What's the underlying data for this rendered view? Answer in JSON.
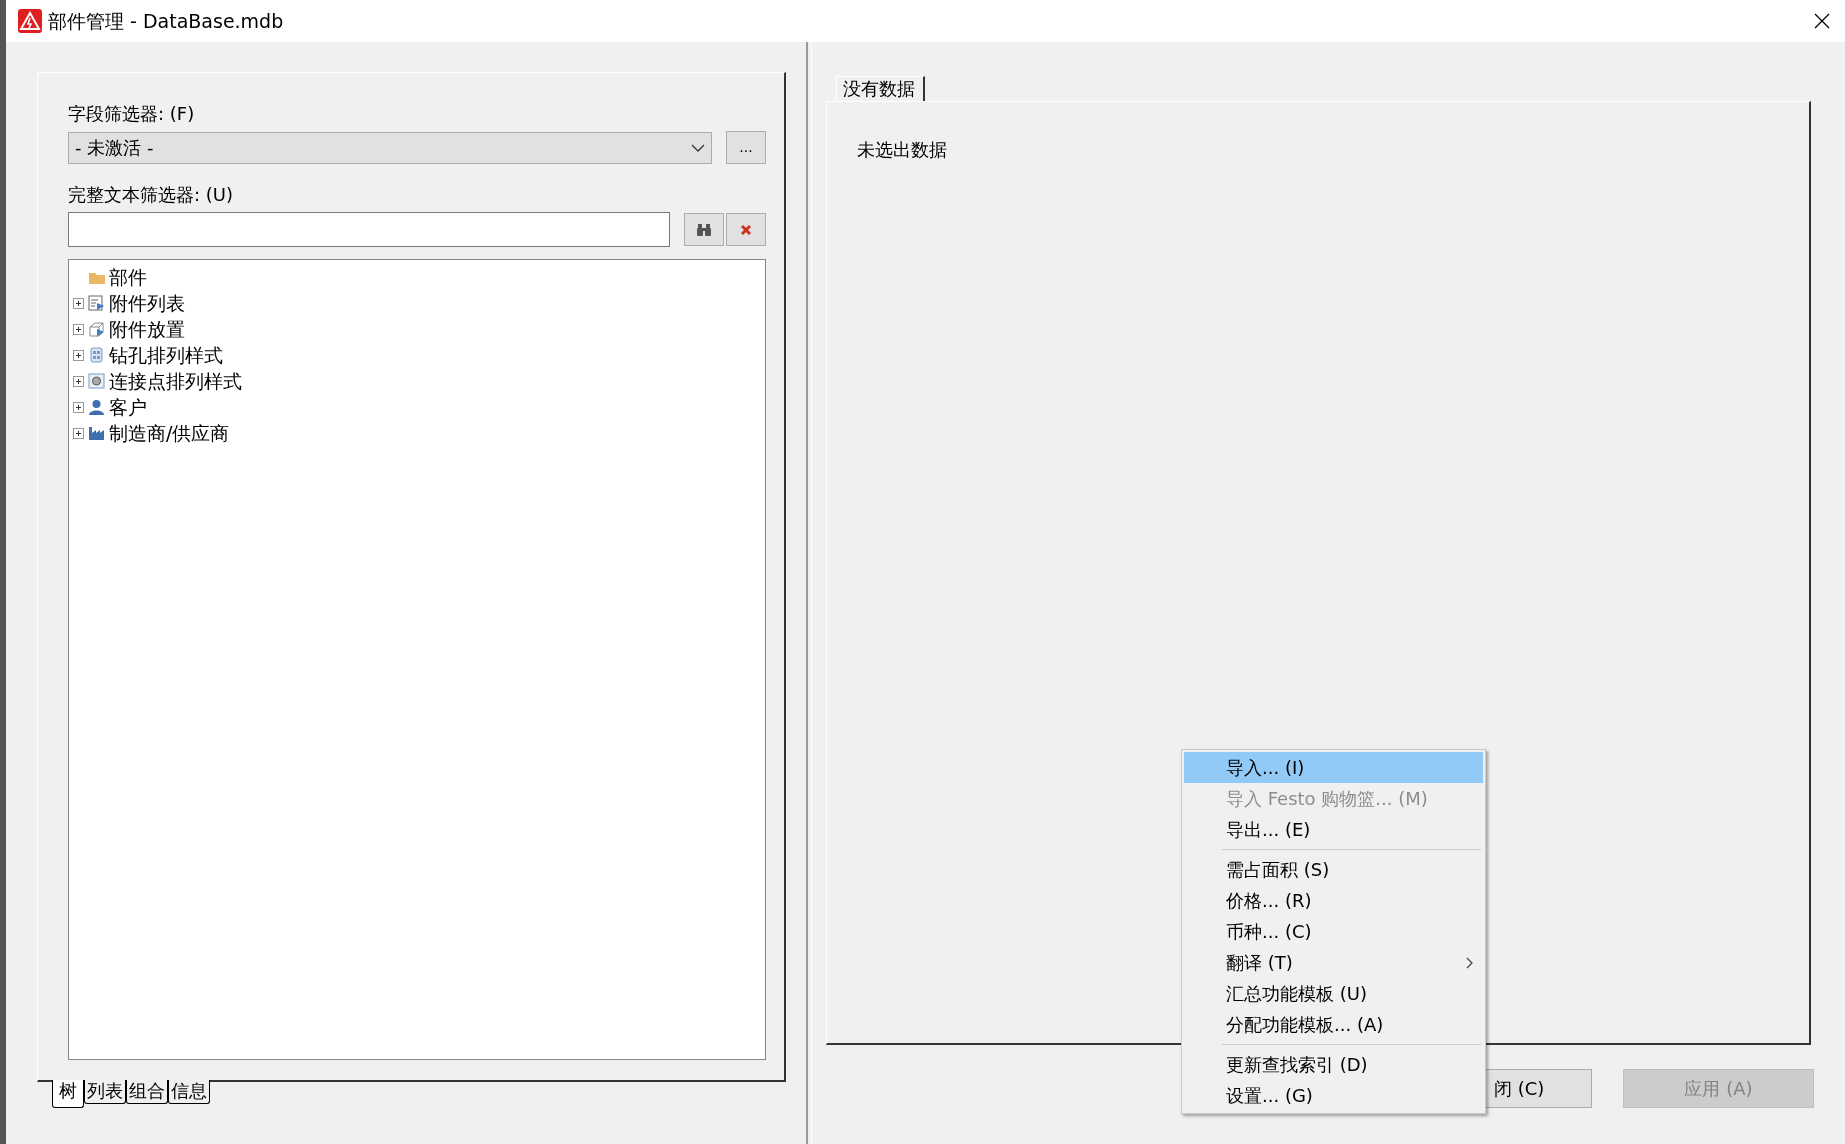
{
  "window": {
    "title": "部件管理 - DataBase.mdb"
  },
  "field_filter": {
    "label": "字段筛选器: (F)",
    "value": "- 未激活 -",
    "more_button": "..."
  },
  "text_filter": {
    "label": "完整文本筛选器: (U)"
  },
  "tree": [
    {
      "label": "部件",
      "kind": "folder",
      "expandable": false
    },
    {
      "label": "附件列表",
      "kind": "list",
      "expandable": true
    },
    {
      "label": "附件放置",
      "kind": "placement",
      "expandable": true
    },
    {
      "label": "钻孔排列样式",
      "kind": "drill",
      "expandable": true
    },
    {
      "label": "连接点排列样式",
      "kind": "connector",
      "expandable": true
    },
    {
      "label": "客户",
      "kind": "customer",
      "expandable": true
    },
    {
      "label": "制造商/供应商",
      "kind": "factory",
      "expandable": true
    }
  ],
  "left_tabs": [
    {
      "label": "树",
      "selected": true
    },
    {
      "label": "列表",
      "selected": false
    },
    {
      "label": "组合",
      "selected": false
    },
    {
      "label": "信息",
      "selected": false
    }
  ],
  "right_tab": {
    "label": "没有数据"
  },
  "right_message": "未选出数据",
  "buttons": [
    {
      "label": "闭 (C)",
      "disabled": false
    },
    {
      "label": "应用 (A)",
      "disabled": true
    }
  ],
  "context_menu": [
    {
      "kind": "item",
      "label": "导入... (I)",
      "selected": true,
      "disabled": false,
      "submenu": false
    },
    {
      "kind": "item",
      "label": "导入 Festo 购物篮... (M)",
      "selected": false,
      "disabled": true,
      "submenu": false
    },
    {
      "kind": "item",
      "label": "导出... (E)",
      "selected": false,
      "disabled": false,
      "submenu": false
    },
    {
      "kind": "separator"
    },
    {
      "kind": "item",
      "label": "需占面积 (S)",
      "selected": false,
      "disabled": false,
      "submenu": false
    },
    {
      "kind": "item",
      "label": "价格... (R)",
      "selected": false,
      "disabled": false,
      "submenu": false
    },
    {
      "kind": "item",
      "label": "币种... (C)",
      "selected": false,
      "disabled": false,
      "submenu": false
    },
    {
      "kind": "item",
      "label": "翻译 (T)",
      "selected": false,
      "disabled": false,
      "submenu": true
    },
    {
      "kind": "item",
      "label": "汇总功能模板 (U)",
      "selected": false,
      "disabled": false,
      "submenu": false
    },
    {
      "kind": "item",
      "label": "分配功能模板... (A)",
      "selected": false,
      "disabled": false,
      "submenu": false
    },
    {
      "kind": "separator"
    },
    {
      "kind": "item",
      "label": "更新查找索引 (D)",
      "selected": false,
      "disabled": false,
      "submenu": false
    },
    {
      "kind": "item",
      "label": "设置... (G)",
      "selected": false,
      "disabled": false,
      "submenu": false
    }
  ]
}
